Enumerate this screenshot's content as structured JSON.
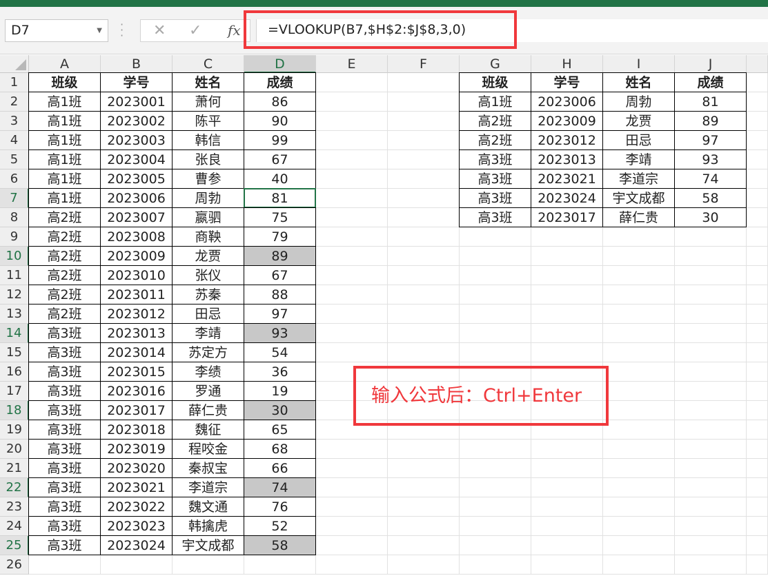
{
  "name_box": "D7",
  "formula": "=VLOOKUP(B7,$H$2:$J$8,3,0)",
  "icons": {
    "cancel": "✕",
    "enter": "✓",
    "function": "fx"
  },
  "active_cell": "D7",
  "columns": [
    "A",
    "B",
    "C",
    "D",
    "E",
    "F",
    "G",
    "H",
    "I",
    "J"
  ],
  "rows": [
    "1",
    "2",
    "3",
    "4",
    "5",
    "6",
    "7",
    "8",
    "9",
    "10",
    "11",
    "12",
    "13",
    "14",
    "15",
    "16",
    "17",
    "18",
    "19",
    "20",
    "21",
    "22",
    "23",
    "24",
    "25",
    "26"
  ],
  "left_table": {
    "headers": [
      "班级",
      "学号",
      "姓名",
      "成绩"
    ],
    "rows": [
      [
        "高1班",
        "2023001",
        "萧何",
        "86"
      ],
      [
        "高1班",
        "2023002",
        "陈平",
        "90"
      ],
      [
        "高1班",
        "2023003",
        "韩信",
        "99"
      ],
      [
        "高1班",
        "2023004",
        "张良",
        "67"
      ],
      [
        "高1班",
        "2023005",
        "曹参",
        "40"
      ],
      [
        "高1班",
        "2023006",
        "周勃",
        "81"
      ],
      [
        "高2班",
        "2023007",
        "嬴驷",
        "75"
      ],
      [
        "高2班",
        "2023008",
        "商鞅",
        "79"
      ],
      [
        "高2班",
        "2023009",
        "龙贾",
        "89"
      ],
      [
        "高2班",
        "2023010",
        "张仪",
        "67"
      ],
      [
        "高2班",
        "2023011",
        "苏秦",
        "88"
      ],
      [
        "高2班",
        "2023012",
        "田忌",
        "97"
      ],
      [
        "高3班",
        "2023013",
        "李靖",
        "93"
      ],
      [
        "高3班",
        "2023014",
        "苏定方",
        "54"
      ],
      [
        "高3班",
        "2023015",
        "李绩",
        "36"
      ],
      [
        "高3班",
        "2023016",
        "罗通",
        "19"
      ],
      [
        "高3班",
        "2023017",
        "薛仁贵",
        "30"
      ],
      [
        "高3班",
        "2023018",
        "魏征",
        "65"
      ],
      [
        "高3班",
        "2023019",
        "程咬金",
        "68"
      ],
      [
        "高3班",
        "2023020",
        "秦叔宝",
        "66"
      ],
      [
        "高3班",
        "2023021",
        "李道宗",
        "74"
      ],
      [
        "高3班",
        "2023022",
        "魏文通",
        "76"
      ],
      [
        "高3班",
        "2023023",
        "韩擒虎",
        "52"
      ],
      [
        "高3班",
        "2023024",
        "宇文成都",
        "58"
      ]
    ],
    "highlighted_rows": [
      10,
      14,
      18,
      22,
      25
    ]
  },
  "right_table": {
    "headers": [
      "班级",
      "学号",
      "姓名",
      "成绩"
    ],
    "rows": [
      [
        "高1班",
        "2023006",
        "周勃",
        "81"
      ],
      [
        "高2班",
        "2023009",
        "龙贾",
        "89"
      ],
      [
        "高2班",
        "2023012",
        "田忌",
        "97"
      ],
      [
        "高3班",
        "2023013",
        "李靖",
        "93"
      ],
      [
        "高3班",
        "2023021",
        "李道宗",
        "74"
      ],
      [
        "高3班",
        "2023024",
        "宇文成都",
        "58"
      ],
      [
        "高3班",
        "2023017",
        "薛仁贵",
        "30"
      ]
    ]
  },
  "note": "输入公式后：Ctrl+Enter",
  "colors": {
    "accent": "#217346",
    "highlight_border": "#f0383c",
    "selected_fill": "#c8c8c8"
  }
}
